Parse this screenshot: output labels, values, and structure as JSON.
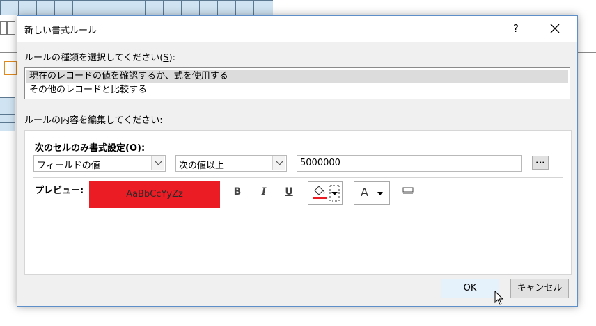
{
  "dialog": {
    "title": "新しい書式ルール",
    "help": "?",
    "rule_type_label": "ルールの種類を選択してください(",
    "rule_type_key": "S",
    "rule_type_label_end": "):",
    "rule_types": [
      "現在のレコードの値を確認するか、式を使用する",
      "その他のレコードと比較する"
    ],
    "edit_label": "ルールの内容を編集してください:",
    "condition_label": "次のセルのみ書式設定(",
    "condition_key": "O",
    "condition_label_end": "):",
    "field_select": "フィールドの値",
    "operator_select": "次の値以上",
    "value": "5000000",
    "ellipsis": "...",
    "preview_label": "プレビュー:",
    "preview_text": "AaBbCcYyZz",
    "preview_bg": "#ec1c24",
    "bold": "B",
    "italic": "I",
    "underline": "U",
    "font_color": "A",
    "ok": "OK",
    "cancel": "キャンセル"
  }
}
